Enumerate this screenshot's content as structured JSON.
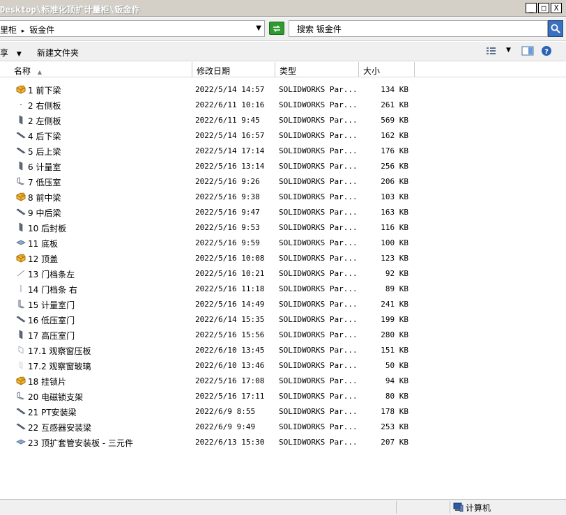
{
  "window": {
    "title": "Desktop\\标准化顶扩计量柜\\钣金件",
    "min": "_",
    "max": "□",
    "close": "X"
  },
  "address": {
    "crumb1": "里柜",
    "sep": "▸",
    "crumb2": "钣金件",
    "dropdown": "▼"
  },
  "search": {
    "value": "搜索 钣金件"
  },
  "toolbar": {
    "share_label": "享",
    "share_arrow": "▼",
    "new_folder_label": "新建文件夹",
    "view_arrow": "▼"
  },
  "columns": {
    "name": "名称",
    "sort_arrow": "▲",
    "date": "修改日期",
    "type": "类型",
    "size": "大小"
  },
  "files": [
    {
      "name": "1 前下梁",
      "date": "2022/5/14 14:57",
      "type": "SOLIDWORKS Par...",
      "size": "134 KB",
      "icon": "assembly-icon"
    },
    {
      "name": "2 右侧板",
      "date": "2022/6/11 10:16",
      "type": "SOLIDWORKS Par...",
      "size": "261 KB",
      "icon": "dot-part-icon"
    },
    {
      "name": "2 左侧板",
      "date": "2022/6/11 9:45",
      "type": "SOLIDWORKS Par...",
      "size": "569 KB",
      "icon": "panel-part-icon"
    },
    {
      "name": "4 后下梁",
      "date": "2022/5/14 16:57",
      "type": "SOLIDWORKS Par...",
      "size": "162 KB",
      "icon": "beam-part-icon"
    },
    {
      "name": "5 后上梁",
      "date": "2022/5/14 17:14",
      "type": "SOLIDWORKS Par...",
      "size": "176 KB",
      "icon": "beam-part-icon"
    },
    {
      "name": "6 计量室",
      "date": "2022/5/16 13:14",
      "type": "SOLIDWORKS Par...",
      "size": "256 KB",
      "icon": "panel-part-icon"
    },
    {
      "name": "7 低压室",
      "date": "2022/5/16 9:26",
      "type": "SOLIDWORKS Par...",
      "size": "206 KB",
      "icon": "bracket-part-icon"
    },
    {
      "name": "8 前中梁",
      "date": "2022/5/16 9:38",
      "type": "SOLIDWORKS Par...",
      "size": "103 KB",
      "icon": "assembly-icon"
    },
    {
      "name": "9 中后梁",
      "date": "2022/5/16 9:47",
      "type": "SOLIDWORKS Par...",
      "size": "163 KB",
      "icon": "beam-part-icon"
    },
    {
      "name": "10 后封板",
      "date": "2022/5/16 9:53",
      "type": "SOLIDWORKS Par...",
      "size": "116 KB",
      "icon": "panel-part-icon"
    },
    {
      "name": "11 底板",
      "date": "2022/5/16 9:59",
      "type": "SOLIDWORKS Par...",
      "size": "100 KB",
      "icon": "plate-part-icon"
    },
    {
      "name": "12 顶盖",
      "date": "2022/5/16 10:08",
      "type": "SOLIDWORKS Par...",
      "size": "123 KB",
      "icon": "assembly-icon"
    },
    {
      "name": "13 门档条左",
      "date": "2022/5/16 10:21",
      "type": "SOLIDWORKS Par...",
      "size": "92 KB",
      "icon": "strip-part-icon"
    },
    {
      "name": "14 门档条 右",
      "date": "2022/5/16 11:18",
      "type": "SOLIDWORKS Par...",
      "size": "89 KB",
      "icon": "thin-part-icon"
    },
    {
      "name": "15 计量室门",
      "date": "2022/5/16 14:49",
      "type": "SOLIDWORKS Par...",
      "size": "241 KB",
      "icon": "door-part-icon"
    },
    {
      "name": "16 低压室门",
      "date": "2022/6/14 15:35",
      "type": "SOLIDWORKS Par...",
      "size": "199 KB",
      "icon": "beam-part-icon"
    },
    {
      "name": "17 高压室门",
      "date": "2022/5/16 15:56",
      "type": "SOLIDWORKS Par...",
      "size": "280 KB",
      "icon": "panel-part-icon"
    },
    {
      "name": "17.1 观察窗压板",
      "date": "2022/6/10 13:45",
      "type": "SOLIDWORKS Par...",
      "size": "151 KB",
      "icon": "frame-part-icon"
    },
    {
      "name": "17.2 观察窗玻璃",
      "date": "2022/6/10 13:46",
      "type": "SOLIDWORKS Par...",
      "size": "50 KB",
      "icon": "glass-part-icon"
    },
    {
      "name": "18 挂锁片",
      "date": "2022/5/16 17:08",
      "type": "SOLIDWORKS Par...",
      "size": "94 KB",
      "icon": "assembly-icon"
    },
    {
      "name": "20 电磁锁支架",
      "date": "2022/5/16 17:11",
      "type": "SOLIDWORKS Par...",
      "size": "80 KB",
      "icon": "bracket-part-icon"
    },
    {
      "name": "21 PT安装梁",
      "date": "2022/6/9 8:55",
      "type": "SOLIDWORKS Par...",
      "size": "178 KB",
      "icon": "beam-part-icon"
    },
    {
      "name": "22 互感器安装梁",
      "date": "2022/6/9 9:49",
      "type": "SOLIDWORKS Par...",
      "size": "253 KB",
      "icon": "beam-part-icon"
    },
    {
      "name": "23 顶扩套管安装板 - 三元件",
      "date": "2022/6/13 15:30",
      "type": "SOLIDWORKS Par...",
      "size": "207 KB",
      "icon": "plate-part-icon"
    }
  ],
  "status": {
    "location": "计算机"
  }
}
